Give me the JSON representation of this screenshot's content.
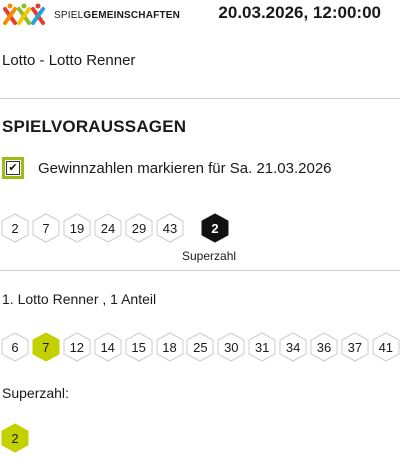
{
  "header": {
    "logo_text_light": "SPIEL",
    "logo_text_bold": "GEMEINSCHAFTEN",
    "datetime": "20.03.2026, 12:00:00"
  },
  "game": {
    "name": "Lotto - Lotto Renner"
  },
  "predictions": {
    "title": "SPIELVORAUSSAGEN",
    "checkbox_checked": true,
    "checkbox_label": "Gewinnzahlen markieren für Sa. 21.03.2026",
    "numbers": [
      "2",
      "7",
      "19",
      "24",
      "29",
      "43"
    ],
    "superzahl": "2",
    "superzahl_caption": "Superzahl"
  },
  "tip": {
    "title": "1. Lotto Renner , 1 Anteil",
    "numbers": [
      "6",
      "7",
      "12",
      "14",
      "15",
      "18",
      "25",
      "30",
      "31",
      "34",
      "36",
      "37",
      "41"
    ],
    "highlighted": [
      "7"
    ],
    "superzahl_label": "Superzahl:",
    "superzahl": "2"
  },
  "colors": {
    "accent": "#c3d100",
    "dark": "#111111",
    "hex_border": "#cccccc",
    "checkbox_border": "#9bbd15"
  }
}
